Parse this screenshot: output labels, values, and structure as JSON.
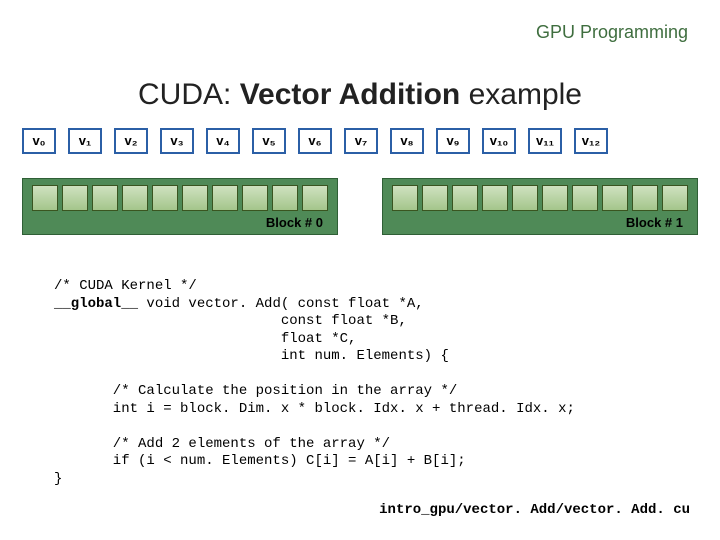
{
  "header": "GPU Programming",
  "title": {
    "prefix": "CUDA:  ",
    "bold": "Vector Addition",
    "suffix": "  example"
  },
  "vlabels": [
    "v₀",
    "v₁",
    "v₂",
    "v₃",
    "v₄",
    "v₅",
    "v₆",
    "v₇",
    "v₈",
    "v₉",
    "v₁₀",
    "v₁₁",
    "v₁₂"
  ],
  "blocks": [
    {
      "label": "Block # 0",
      "cores": 10
    },
    {
      "label": "Block # 1",
      "cores": 10
    }
  ],
  "code": {
    "c1": "/* CUDA Kernel */",
    "c2a": "__global__",
    "c2b": " void vector. Add( const float *A,",
    "c3": "                           const float *B,",
    "c4": "                           float *C,",
    "c5": "                           int num. Elements) {",
    "c6": "",
    "c7": "       /* Calculate the position in the array */",
    "c8": "       int i = block. Dim. x * block. Idx. x + thread. Idx. x;",
    "c9": "",
    "c10": "       /* Add 2 elements of the array */",
    "c11": "       if (i < num. Elements) C[i] = A[i] + B[i];",
    "c12": "}"
  },
  "footer": "intro_gpu/vector. Add/vector. Add. cu"
}
